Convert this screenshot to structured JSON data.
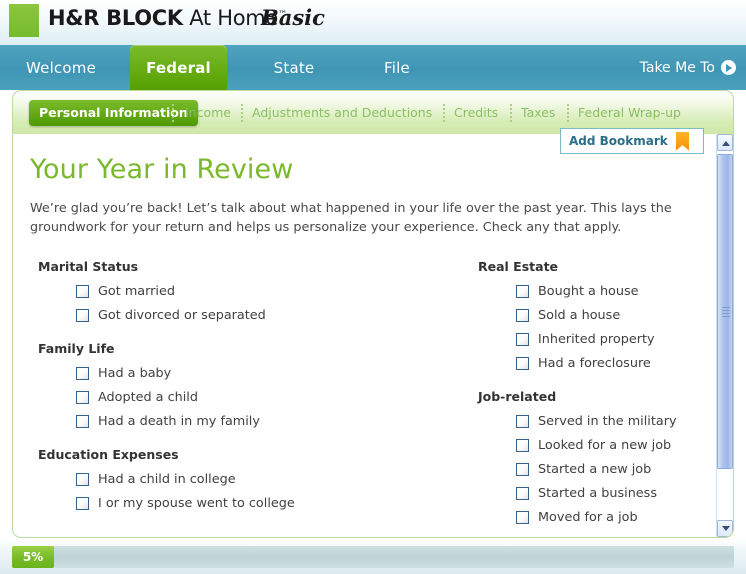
{
  "header": {
    "logo_icon": "green-square-logo",
    "brand_bold": "H&R BLOCK",
    "brand_light": " At Home",
    "brand_tm": "™",
    "edition": "Basic"
  },
  "nav": {
    "items": [
      {
        "label": "Welcome",
        "active": false
      },
      {
        "label": "Federal",
        "active": true
      },
      {
        "label": "State",
        "active": false
      },
      {
        "label": "File",
        "active": false
      }
    ],
    "take_me_to": "Take Me To",
    "take_me_to_icon": "play-circle-icon"
  },
  "subtabs": [
    {
      "label": "Personal Information",
      "active": true
    },
    {
      "label": "Income",
      "active": false
    },
    {
      "label": "Adjustments and Deductions",
      "active": false
    },
    {
      "label": "Credits",
      "active": false
    },
    {
      "label": "Taxes",
      "active": false
    },
    {
      "label": "Federal Wrap-up",
      "active": false
    }
  ],
  "bookmark": {
    "label": "Add Bookmark",
    "icon": "orange-bookmark-flag-icon"
  },
  "page": {
    "title": "Your Year in Review",
    "intro": "We’re glad you’re back! Let’s talk about what happened in your life over the past year. This lays the groundwork for your return and helps us personalize your experience. Check any that apply."
  },
  "left_groups": [
    {
      "title": "Marital Status",
      "items": [
        {
          "label": "Got married",
          "checked": false
        },
        {
          "label": "Got divorced or separated",
          "checked": false
        }
      ]
    },
    {
      "title": "Family Life",
      "items": [
        {
          "label": "Had a baby",
          "checked": false
        },
        {
          "label": "Adopted a child",
          "checked": false
        },
        {
          "label": "Had a death in my family",
          "checked": false
        }
      ]
    },
    {
      "title": "Education Expenses",
      "items": [
        {
          "label": "Had a child in college",
          "checked": false
        },
        {
          "label": "I or my spouse went to college",
          "checked": false
        }
      ]
    }
  ],
  "right_groups": [
    {
      "title": "Real Estate",
      "items": [
        {
          "label": "Bought a house",
          "checked": false
        },
        {
          "label": "Sold a house",
          "checked": false
        },
        {
          "label": "Inherited property",
          "checked": false
        },
        {
          "label": "Had a foreclosure",
          "checked": false
        }
      ]
    },
    {
      "title": "Job-related",
      "items": [
        {
          "label": "Served in the military",
          "checked": false
        },
        {
          "label": "Looked for a new job",
          "checked": false
        },
        {
          "label": "Started a new job",
          "checked": false
        },
        {
          "label": "Started a business",
          "checked": false
        },
        {
          "label": "Moved for a job",
          "checked": false
        }
      ]
    }
  ],
  "scrollbar": {
    "up_icon": "chevron-up-icon",
    "down_icon": "chevron-down-icon"
  },
  "progress": {
    "percent_label": "5%",
    "percent_value": 5
  },
  "colors": {
    "brand_green": "#76bb2e",
    "nav_teal": "#3f96b4",
    "title_green": "#7ab92d",
    "bookmark_orange": "#f59300",
    "bookmark_text": "#2a6e87"
  }
}
